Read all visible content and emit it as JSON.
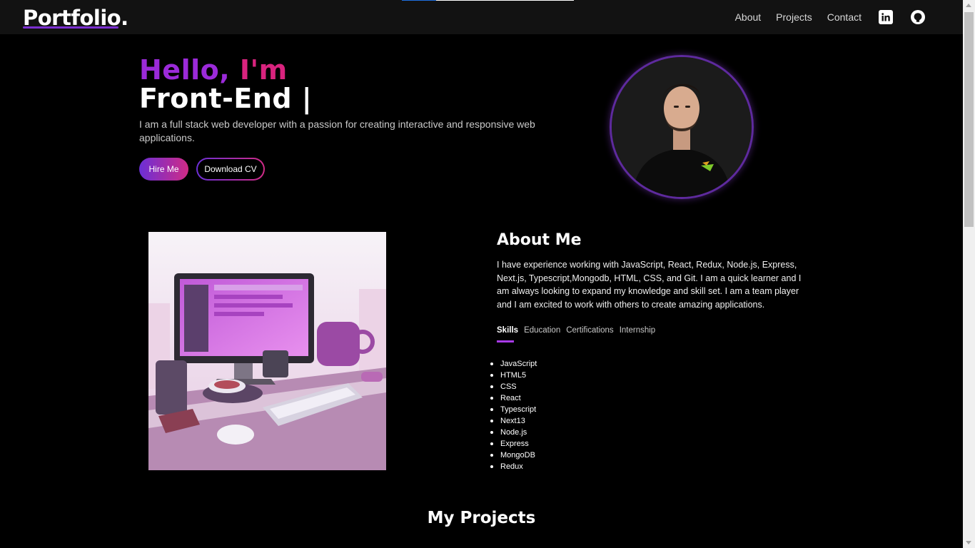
{
  "nav": {
    "logo": "Portfolio.",
    "links": [
      "About",
      "Projects",
      "Contact"
    ],
    "linkedin_icon": "linkedin-icon",
    "github_icon": "github-icon",
    "scroll_progress": 0.2
  },
  "hero": {
    "hello": "Hello,",
    "im": " I'm",
    "role": "Front-End |",
    "description": "I am a full stack web developer with a passion for creating interactive and responsive web applications.",
    "hire_label": "Hire Me",
    "cv_label": "Download CV"
  },
  "about": {
    "title": "About Me",
    "description": "I have experience working with JavaScript, React, Redux, Node.js, Express, Next.js, Typescript,Mongodb, HTML, CSS, and Git. I am a quick learner and I am always looking to expand my knowledge and skill set. I am a team player and I am excited to work with others to create amazing applications.",
    "tabs": [
      "Skills",
      "Education",
      "Certifications",
      "Internship"
    ],
    "active_tab": "Skills",
    "skills": [
      "JavaScript",
      "HTML5",
      "CSS",
      "React",
      "Typescript",
      "Next13",
      "Node.js",
      "Express",
      "MongoDB",
      "Redux"
    ]
  },
  "projects": {
    "title": "My Projects"
  },
  "colors": {
    "accent_purple": "#9b2ad9",
    "accent_pink": "#d9237e",
    "navbar_bg": "#121212"
  }
}
